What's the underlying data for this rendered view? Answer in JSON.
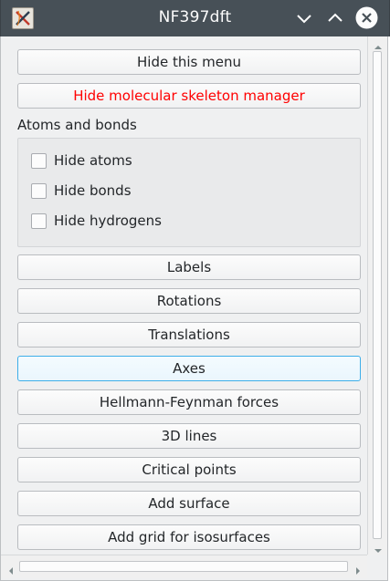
{
  "window": {
    "title": "NF397dft",
    "app_icon": "x-window-icon",
    "controls": [
      "minimize-icon",
      "maximize-icon",
      "close-icon"
    ]
  },
  "menu": {
    "hide_menu": "Hide this menu",
    "hide_skeleton": "Hide molecular skeleton manager",
    "atoms_bonds_title": "Atoms and bonds",
    "checkboxes": [
      {
        "label": "Hide atoms",
        "checked": false
      },
      {
        "label": "Hide bonds",
        "checked": false
      },
      {
        "label": "Hide hydrogens",
        "checked": false
      }
    ],
    "buttons": [
      "Labels",
      "Rotations",
      "Translations",
      "Axes",
      "Hellmann-Feynman forces",
      "3D lines",
      "Critical points",
      "Add surface",
      "Add grid for isosurfaces"
    ]
  },
  "colors": {
    "titlebar": "#475057",
    "warning_text": "#ff0000",
    "focus_border": "#3daee9"
  }
}
